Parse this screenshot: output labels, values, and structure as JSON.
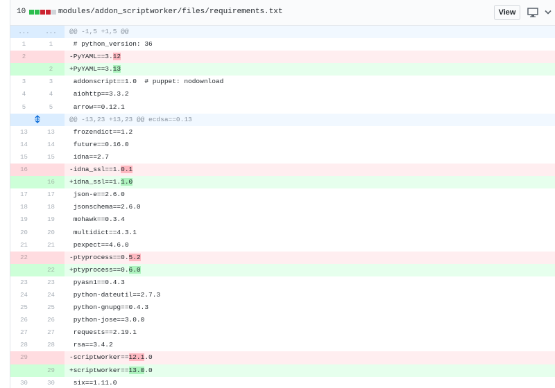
{
  "file": {
    "change_count": "10",
    "diffstat_colors": [
      "#2cbe4e",
      "#2cbe4e",
      "#cb2431",
      "#cb2431",
      "#d1d5da"
    ],
    "path": "modules/addon_scriptworker/files/requirements.txt",
    "view_button": "View",
    "display_icon": "desktop-icon",
    "collapse_icon": "chevron-down-icon"
  },
  "colors": {
    "deleted_line": "#ffeef0",
    "added_line": "#e6ffed",
    "hunk_header": "#f1f8ff"
  },
  "lines": [
    {
      "type": "hunk",
      "old": "...",
      "new": "...",
      "text": "@@ -1,5 +1,5 @@"
    },
    {
      "type": "ctx",
      "old": "1",
      "new": "1",
      "pre": " # python_version: 36",
      "mark": "",
      "post": ""
    },
    {
      "type": "del",
      "old": "2",
      "new": "",
      "pre": "-PyYAML==3.",
      "mark": "12",
      "post": ""
    },
    {
      "type": "add",
      "old": "",
      "new": "2",
      "pre": "+PyYAML==3.",
      "mark": "13",
      "post": ""
    },
    {
      "type": "ctx",
      "old": "3",
      "new": "3",
      "pre": " addonscript==1.0  # puppet: nodownload",
      "mark": "",
      "post": ""
    },
    {
      "type": "ctx",
      "old": "4",
      "new": "4",
      "pre": " aiohttp==3.3.2",
      "mark": "",
      "post": ""
    },
    {
      "type": "ctx",
      "old": "5",
      "new": "5",
      "pre": " arrow==0.12.1",
      "mark": "",
      "post": ""
    },
    {
      "type": "expand",
      "icon": "unfold-icon",
      "text": "@@ -13,23 +13,23 @@ ecdsa==0.13"
    },
    {
      "type": "ctx",
      "old": "13",
      "new": "13",
      "pre": " frozendict==1.2",
      "mark": "",
      "post": ""
    },
    {
      "type": "ctx",
      "old": "14",
      "new": "14",
      "pre": " future==0.16.0",
      "mark": "",
      "post": ""
    },
    {
      "type": "ctx",
      "old": "15",
      "new": "15",
      "pre": " idna==2.7",
      "mark": "",
      "post": ""
    },
    {
      "type": "del",
      "old": "16",
      "new": "",
      "pre": "-idna_ssl==1.",
      "mark": "0.1",
      "post": ""
    },
    {
      "type": "add",
      "old": "",
      "new": "16",
      "pre": "+idna_ssl==1.",
      "mark": "1.0",
      "post": ""
    },
    {
      "type": "ctx",
      "old": "17",
      "new": "17",
      "pre": " json-e==2.6.0",
      "mark": "",
      "post": ""
    },
    {
      "type": "ctx",
      "old": "18",
      "new": "18",
      "pre": " jsonschema==2.6.0",
      "mark": "",
      "post": ""
    },
    {
      "type": "ctx",
      "old": "19",
      "new": "19",
      "pre": " mohawk==0.3.4",
      "mark": "",
      "post": ""
    },
    {
      "type": "ctx",
      "old": "20",
      "new": "20",
      "pre": " multidict==4.3.1",
      "mark": "",
      "post": ""
    },
    {
      "type": "ctx",
      "old": "21",
      "new": "21",
      "pre": " pexpect==4.6.0",
      "mark": "",
      "post": ""
    },
    {
      "type": "del",
      "old": "22",
      "new": "",
      "pre": "-ptyprocess==0.",
      "mark": "5.2",
      "post": ""
    },
    {
      "type": "add",
      "old": "",
      "new": "22",
      "pre": "+ptyprocess==0.",
      "mark": "6.0",
      "post": ""
    },
    {
      "type": "ctx",
      "old": "23",
      "new": "23",
      "pre": " pyasn1==0.4.3",
      "mark": "",
      "post": ""
    },
    {
      "type": "ctx",
      "old": "24",
      "new": "24",
      "pre": " python-dateutil==2.7.3",
      "mark": "",
      "post": ""
    },
    {
      "type": "ctx",
      "old": "25",
      "new": "25",
      "pre": " python-gnupg==0.4.3",
      "mark": "",
      "post": ""
    },
    {
      "type": "ctx",
      "old": "26",
      "new": "26",
      "pre": " python-jose==3.0.0",
      "mark": "",
      "post": ""
    },
    {
      "type": "ctx",
      "old": "27",
      "new": "27",
      "pre": " requests==2.19.1",
      "mark": "",
      "post": ""
    },
    {
      "type": "ctx",
      "old": "28",
      "new": "28",
      "pre": " rsa==3.4.2",
      "mark": "",
      "post": ""
    },
    {
      "type": "del",
      "old": "29",
      "new": "",
      "pre": "-scriptworker==",
      "mark": "12.1",
      "post": ".0"
    },
    {
      "type": "add",
      "old": "",
      "new": "29",
      "pre": "+scriptworker==",
      "mark": "13.0",
      "post": ".0"
    },
    {
      "type": "ctx",
      "old": "30",
      "new": "30",
      "pre": " six==1.11.0",
      "mark": "",
      "post": ""
    }
  ]
}
